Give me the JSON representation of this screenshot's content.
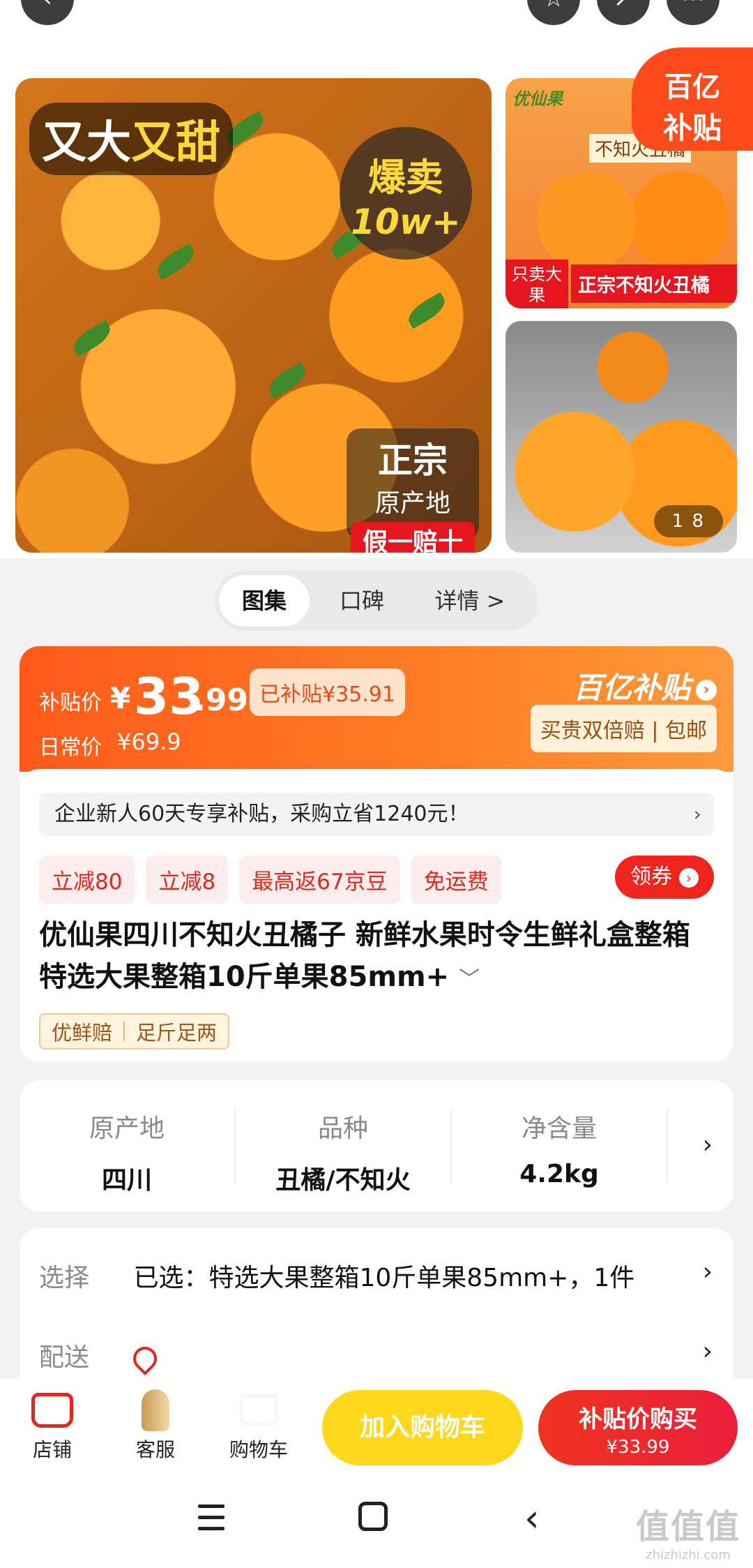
{
  "gallery": {
    "main_title_white": "又大",
    "main_title_yellow": "又甜",
    "hot_badge_line1": "爆卖",
    "hot_badge_line2": "10w+",
    "origin_line1": "正宗",
    "origin_line2": "原产地",
    "origin_line3": "假一赔十",
    "side1_brand": "优仙果",
    "side1_box_title": "不知火丑橘",
    "side1_only": "只卖大果",
    "side1_genuine": "正宗不知火丑橘",
    "page_indicator": "1  8",
    "subsidy_corner_line1": "百亿",
    "subsidy_corner_line2": "补贴"
  },
  "tabs": [
    {
      "label": "图集"
    },
    {
      "label": "口碑"
    },
    {
      "label": "详情 >"
    }
  ],
  "price": {
    "label": "补贴价",
    "currency": "¥",
    "integer": "33",
    "decimal": ".99",
    "subsidized": "已补贴¥35.91",
    "daily_label": "日常价",
    "daily_value": "¥69.9",
    "brand_logo": "百亿补贴",
    "brand_tag": "买贵双倍赔 | 包邮"
  },
  "promo": {
    "bar_text": "企业新人60天专享补贴，采购立省1240元！",
    "chips": [
      "立减80",
      "立减8",
      "最高返67京豆",
      "免运费"
    ],
    "coupon_button": "领券"
  },
  "product": {
    "title": "优仙果四川不知火丑橘子 新鲜水果时令生鲜礼盒整箱 特选大果整箱10斤单果85mm+",
    "tags": [
      "优鲜赔",
      "足斤足两"
    ]
  },
  "specs": [
    {
      "label": "原产地",
      "value": "四川"
    },
    {
      "label": "品种",
      "value": "丑橘/不知火"
    },
    {
      "label": "净含量",
      "value": "4.2kg"
    }
  ],
  "selection": {
    "select_key": "选择",
    "select_value": "已选：特选大果整箱10斤单果85mm+，1件",
    "delivery_key": "配送"
  },
  "bottom_bar": {
    "store": "店铺",
    "service": "客服",
    "cart": "购物车",
    "add_to_cart": "加入购物车",
    "buy_now": "补贴价购买",
    "buy_now_price": "¥33.99"
  },
  "watermark": {
    "line1": "值值值",
    "line2": "zhizhizhi.com"
  }
}
